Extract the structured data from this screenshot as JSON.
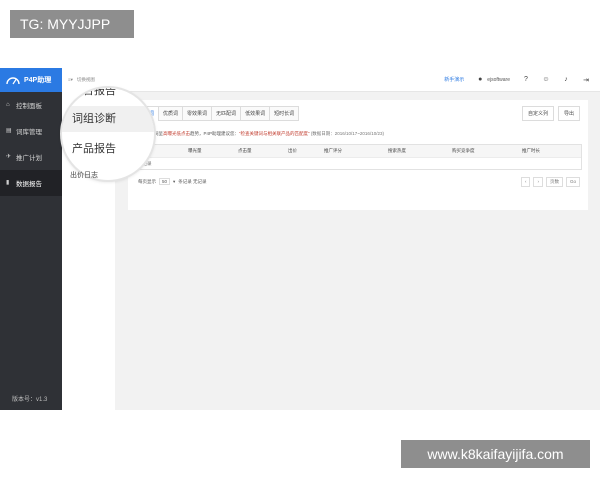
{
  "tag": "TG: MYYJJPP",
  "watermark": "www.k8kaifayijifa.com",
  "sidebar": {
    "brand": "P4P助理",
    "items": [
      {
        "label": "控制面板",
        "icon": "home-icon"
      },
      {
        "label": "词库管理",
        "icon": "book-icon"
      },
      {
        "label": "推广计划",
        "icon": "plane-icon"
      },
      {
        "label": "数据报告",
        "icon": "bar-chart-icon"
      }
    ],
    "version": "版本号：v1.3"
  },
  "subnav": {
    "breadcrumb": "切换视图",
    "lens_items": [
      "综合报告",
      "词组诊断",
      "产品报告"
    ],
    "tail_item": "出价日志"
  },
  "topbar": {
    "newbie": "新手演示",
    "user": "ejsoftware"
  },
  "tabs": [
    "点击词",
    "优质词",
    "零效果词",
    "无匹配词",
    "低效果词",
    "短时长词"
  ],
  "actions": {
    "custom": "自定义列",
    "export": "导出"
  },
  "hint": {
    "prefix": "以下关键词呈",
    "red1": "高曝光低点击",
    "middle": "趋势，P4P助理建议您：",
    "red2": "“检查关键词与相关联产品的匹配度”",
    "date": "(数据日期：2016/10/17~2016/10/23)"
  },
  "table": {
    "headers": [
      "关键词",
      "曝光量",
      "点击量",
      "出价",
      "推广评分",
      "搜索热度",
      "购买竞争度",
      "推广时长"
    ],
    "empty": "无记录"
  },
  "pager": {
    "prefix": "每页显示",
    "size": "50",
    "suffix": "条记录 无记录",
    "page_label": "页数",
    "go": "Go"
  }
}
